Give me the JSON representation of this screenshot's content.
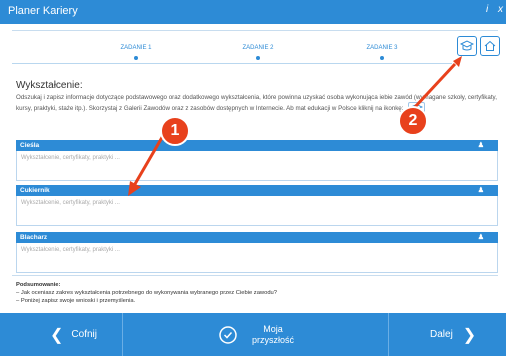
{
  "window": {
    "title": "Planer Kariery",
    "info_label": "i",
    "close_label": "x"
  },
  "steps": [
    "ZADANIE 1",
    "ZADANIE 2",
    "ZADANIE 3"
  ],
  "content": {
    "heading": "Wykształcenie:",
    "description": "Odszukaj i zapisz informacje dotyczące podstawowego oraz dodatkowego wykształcenia, które powinna uzyskać osoba wykonująca iebie zawód (wymagane szkoły, certyfikaty, kursy, praktyki, staże itp.). Skorzystaj z Galerii Zawodów oraz z zasobów dostępnych w Internecie. Ab mat edukacji w Polsce kliknij na ikonkę:"
  },
  "sections": [
    {
      "title": "Cieśla",
      "placeholder": "Wykształcenie, certyfikaty, praktyki ..."
    },
    {
      "title": "Cukiernik",
      "placeholder": "Wykształcenie, certyfikaty, praktyki ..."
    },
    {
      "title": "Blacharz",
      "placeholder": "Wykształcenie, certyfikaty, praktyki ..."
    }
  ],
  "summary": {
    "title": "Podsumowanie:",
    "line1": "– Jak oceniasz zakres wykształcenia potrzebnego do wykonywania wybranego przez Ciebie zawodu?",
    "line2": "– Poniżej zapisz swoje wnioski i przemyślenia."
  },
  "footer": {
    "back": "Cofnij",
    "future_line1": "Moja",
    "future_line2": "przyszłość",
    "next": "Dalej"
  },
  "callouts": [
    "1",
    "2"
  ],
  "colors": {
    "primary": "#2d8bd6",
    "callout": "#e8411c"
  }
}
